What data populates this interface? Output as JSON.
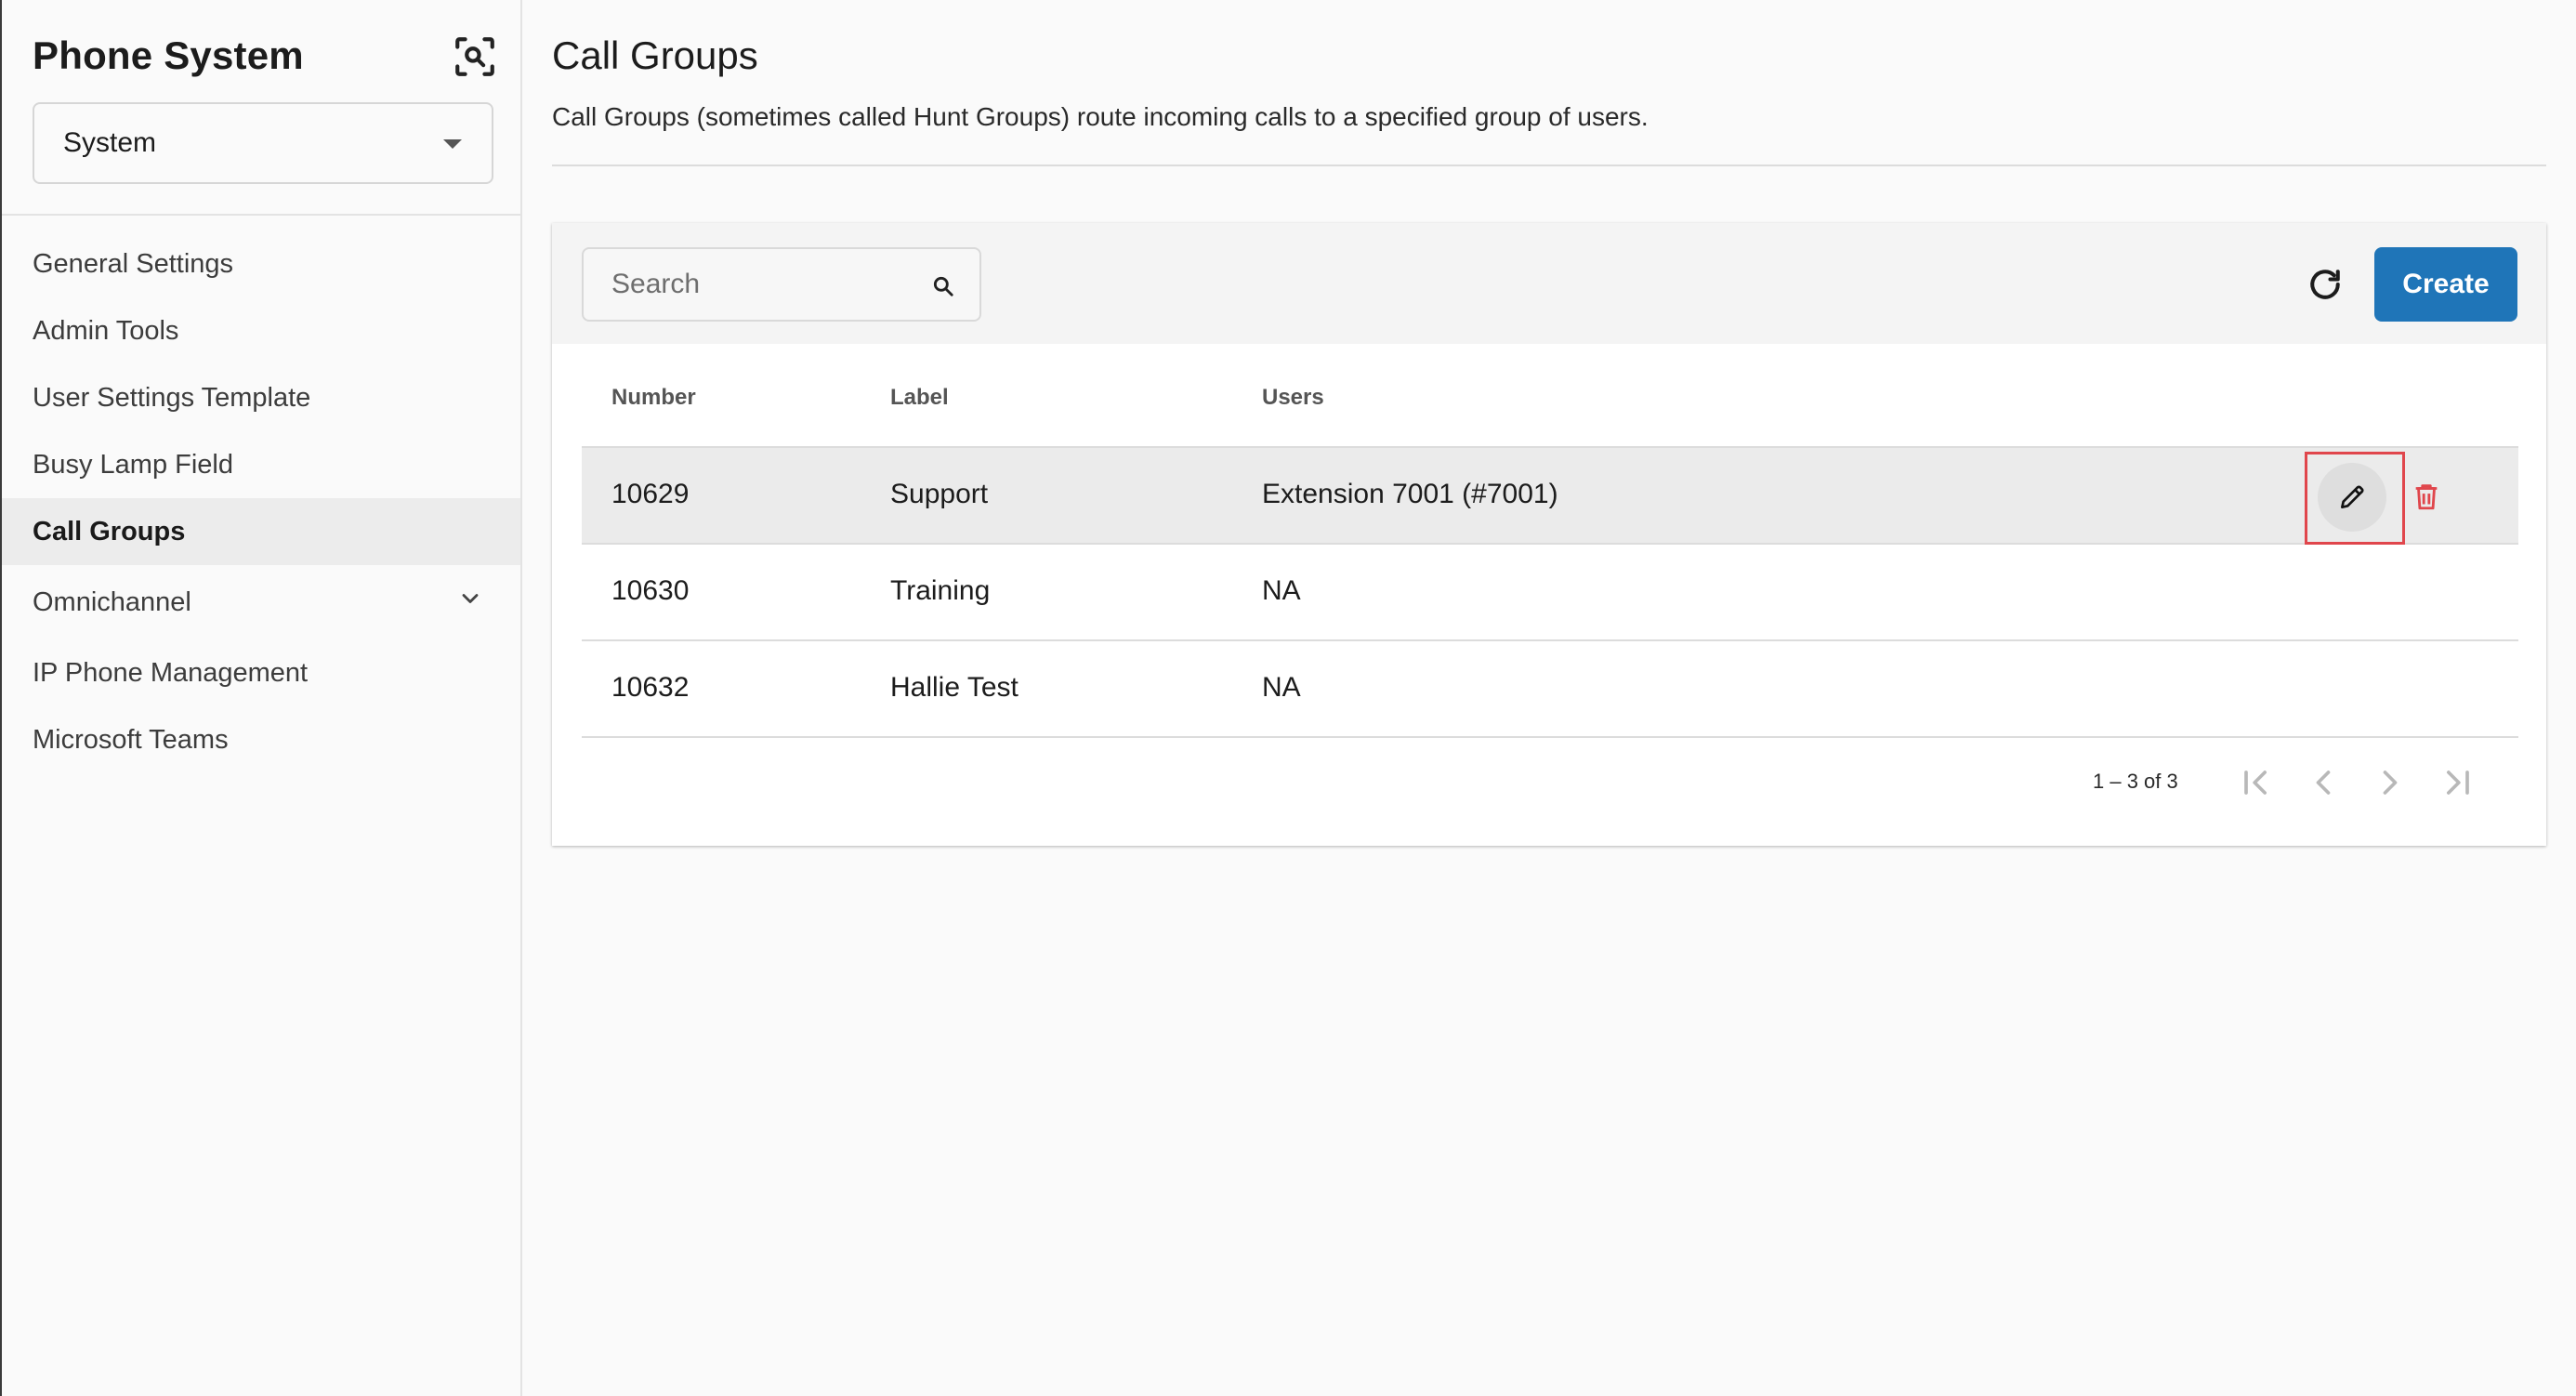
{
  "sidebar": {
    "title": "Phone System",
    "scan_icon": "qr-scan-icon",
    "select": {
      "value": "System"
    },
    "items": [
      {
        "label": "General Settings",
        "active": false
      },
      {
        "label": "Admin Tools",
        "active": false
      },
      {
        "label": "User Settings Template",
        "active": false
      },
      {
        "label": "Busy Lamp Field",
        "active": false
      },
      {
        "label": "Call Groups",
        "active": true
      },
      {
        "label": "Omnichannel",
        "active": false,
        "expandable": true
      },
      {
        "label": "IP Phone Management",
        "active": false
      },
      {
        "label": "Microsoft Teams",
        "active": false
      }
    ]
  },
  "main": {
    "title": "Call Groups",
    "description": "Call Groups (sometimes called Hunt Groups) route incoming calls to a specified group of users.",
    "search": {
      "placeholder": "Search",
      "value": ""
    },
    "create_label": "Create",
    "table": {
      "columns": [
        "Number",
        "Label",
        "Users"
      ],
      "rows": [
        {
          "number": "10629",
          "label": "Support",
          "users": "Extension 7001 (#7001)"
        },
        {
          "number": "10630",
          "label": "Training",
          "users": "NA"
        },
        {
          "number": "10632",
          "label": "Hallie Test",
          "users": "NA"
        }
      ]
    },
    "paginator": {
      "range": "1 – 3 of 3"
    }
  },
  "colors": {
    "accent": "#1f75b8",
    "delete": "#e0464c",
    "highlight": "#e0464c",
    "active_nav_bg": "#ececec"
  }
}
